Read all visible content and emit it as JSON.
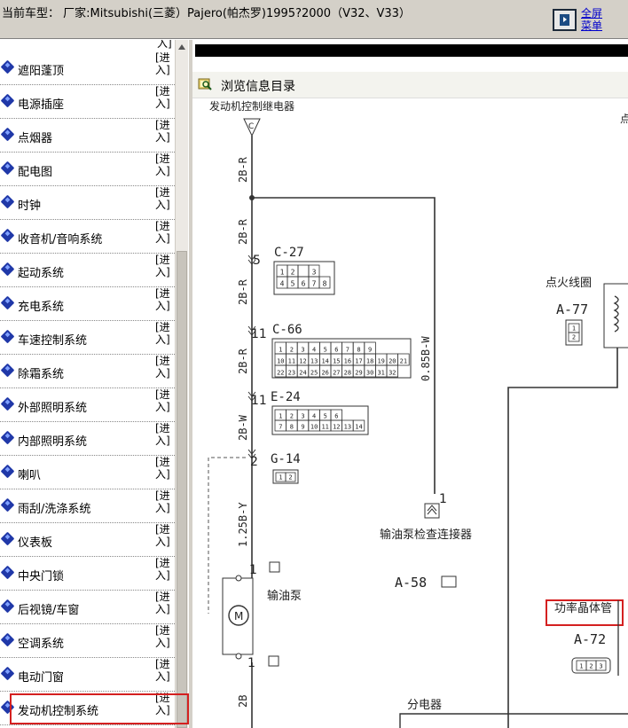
{
  "header": {
    "current_model": "当前车型： 厂家:Mitsubishi(三菱）Pajero(帕杰罗)1995?2000（V32、V33）",
    "fullscreen_line1": "全屏",
    "fullscreen_line2": "菜单"
  },
  "menu": {
    "enter_label": "[进入]",
    "enter_top": "入]",
    "items": [
      {
        "label": "遮阳蓬顶"
      },
      {
        "label": "电源插座"
      },
      {
        "label": "点烟器"
      },
      {
        "label": "配电图"
      },
      {
        "label": "时钟"
      },
      {
        "label": "收音机/音响系统"
      },
      {
        "label": "起动系统"
      },
      {
        "label": "充电系统"
      },
      {
        "label": "车速控制系统"
      },
      {
        "label": "除霜系统"
      },
      {
        "label": "外部照明系统"
      },
      {
        "label": "内部照明系统"
      },
      {
        "label": "喇叭"
      },
      {
        "label": "雨刮/洗涤系统"
      },
      {
        "label": "仪表板"
      },
      {
        "label": "中央门锁"
      },
      {
        "label": "后视镜/车窗"
      },
      {
        "label": "空调系统"
      },
      {
        "label": "电动门窗"
      },
      {
        "label": "发动机控制系统"
      }
    ]
  },
  "content": {
    "toolbar_title": "浏览信息目录",
    "diagram": {
      "top_label": "发动机控制继电器",
      "top_right_char": "点",
      "terminal_c": "C",
      "wire_2b_r": "2B-R",
      "wire_2b_w": "2B-W",
      "wire_125b_y": "1.25B-Y",
      "wire_2b": "2B",
      "wire_085b_w": "0.85B-W",
      "pin_5": "5",
      "pin_11a": "11",
      "pin_11b": "11",
      "pin_2": "2",
      "pin_1a": "1",
      "pin_1b": "1",
      "pin_1c": "1",
      "conn_c27": "C-27",
      "conn_c66": "C-66",
      "conn_e24": "E-24",
      "conn_g14": "G-14",
      "conn_a58": "A-58",
      "conn_a72": "A-72",
      "conn_a77": "A-77",
      "ignition_coil": "点火线圈",
      "fuel_pump_check_connector": "输油泵检查连接器",
      "fuel_pump": "输油泵",
      "power_transistor": "功率晶体管",
      "distributor": "分电器",
      "c27_top": [
        "1",
        "2",
        "",
        "3"
      ],
      "c27_bottom": [
        "4",
        "5",
        "6",
        "7",
        "8"
      ],
      "c66_row1": [
        "1",
        "2",
        "3",
        "4",
        "5",
        "6",
        "7",
        "8",
        "9"
      ],
      "c66_row2": [
        "10",
        "11",
        "12",
        "13",
        "14",
        "15",
        "16",
        "17",
        "18",
        "19",
        "20",
        "21"
      ],
      "c66_row3": [
        "22",
        "23",
        "24",
        "25",
        "26",
        "27",
        "28",
        "29",
        "30",
        "31",
        "32"
      ],
      "e24_row1": [
        "1",
        "2",
        "3",
        "4",
        "5",
        "6"
      ],
      "e24_row2": [
        "7",
        "8",
        "9",
        "10",
        "11",
        "12",
        "13",
        "14"
      ],
      "g14_pins": [
        "1",
        "2"
      ],
      "a72_pins": [
        "1",
        "2",
        "3"
      ],
      "a77_pins": [
        "1",
        "2"
      ]
    }
  }
}
